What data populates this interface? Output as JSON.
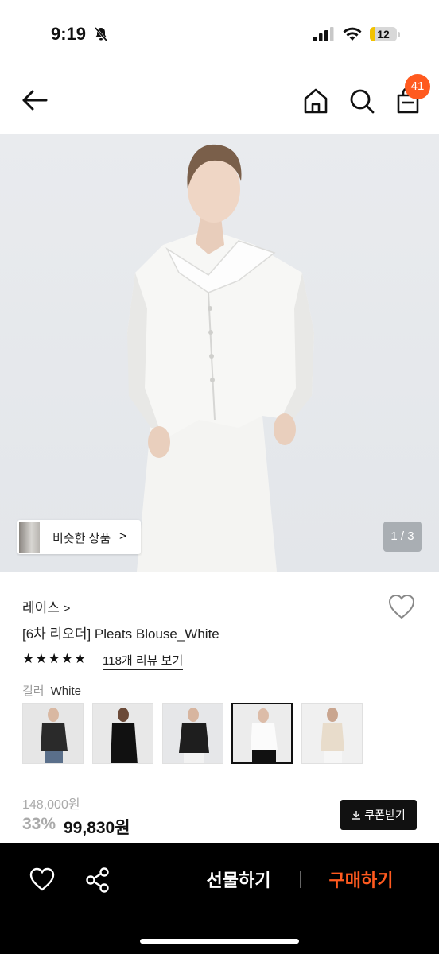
{
  "status_bar": {
    "time": "9:19",
    "battery": "12"
  },
  "header": {
    "cart_count": "41"
  },
  "gallery": {
    "similar_label": "비슷한 상품",
    "similar_chevron": ">",
    "counter": "1 / 3"
  },
  "product": {
    "brand": "레이스",
    "brand_chevron": ">",
    "title": "[6차 리오더] Pleats Blouse_White",
    "rating_stars": "★★★★★",
    "rating": 5,
    "review_link": "118개 리뷰 보기",
    "color_key": "컬러",
    "color_value": "White",
    "original_price": "148,000원",
    "discount": "33%",
    "sale_price": "99,830원",
    "coupon_label": "쿠폰받기"
  },
  "bottom_bar": {
    "gift_label": "선물하기",
    "buy_label": "구매하기"
  },
  "colors": {
    "accent": "#ff5a1f",
    "bar": "#000000"
  },
  "icons": [
    "bell-slash-icon",
    "signal-icon",
    "wifi-icon",
    "battery-icon",
    "back-arrow-icon",
    "home-icon",
    "search-icon",
    "shopping-bag-icon",
    "chevron-right-icon",
    "heart-outline-icon",
    "star-icon",
    "download-icon",
    "share-icon"
  ]
}
